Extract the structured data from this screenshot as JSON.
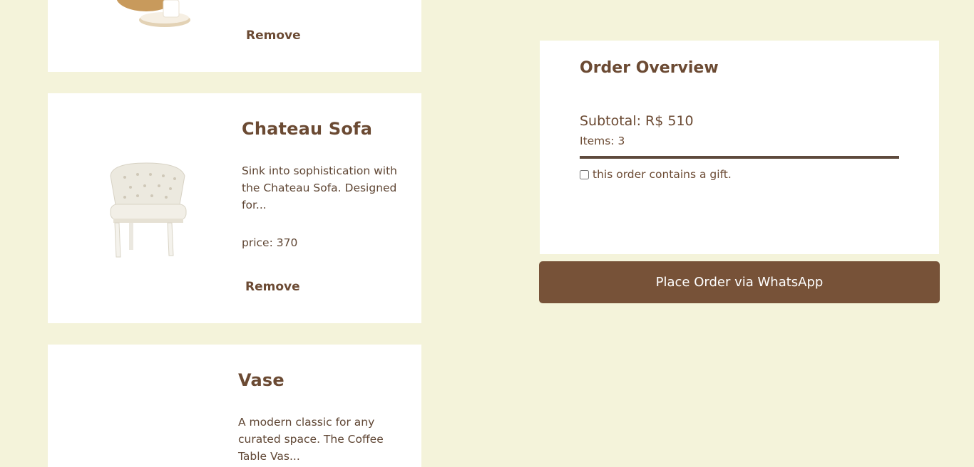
{
  "cart": {
    "items": [
      {
        "remove_label": "Remove"
      },
      {
        "title": "Chateau Sofa",
        "description": "Sink into sophistication with the Chateau Sofa. Designed for...",
        "price": "price: 370",
        "remove_label": "Remove"
      },
      {
        "title": "Vase",
        "description": "A modern classic for any curated space. The Coffee Table Vas..."
      }
    ]
  },
  "overview": {
    "title": "Order Overview",
    "subtotal": "Subtotal: R$ 510",
    "items_count": "Items: 3",
    "gift_label": "this order contains a gift.",
    "gift_checked": false
  },
  "actions": {
    "place_order_label": "Place Order via WhatsApp"
  },
  "colors": {
    "background": "#f4f3da",
    "card": "#ffffff",
    "accent": "#775238",
    "text": "#6b4a33"
  }
}
